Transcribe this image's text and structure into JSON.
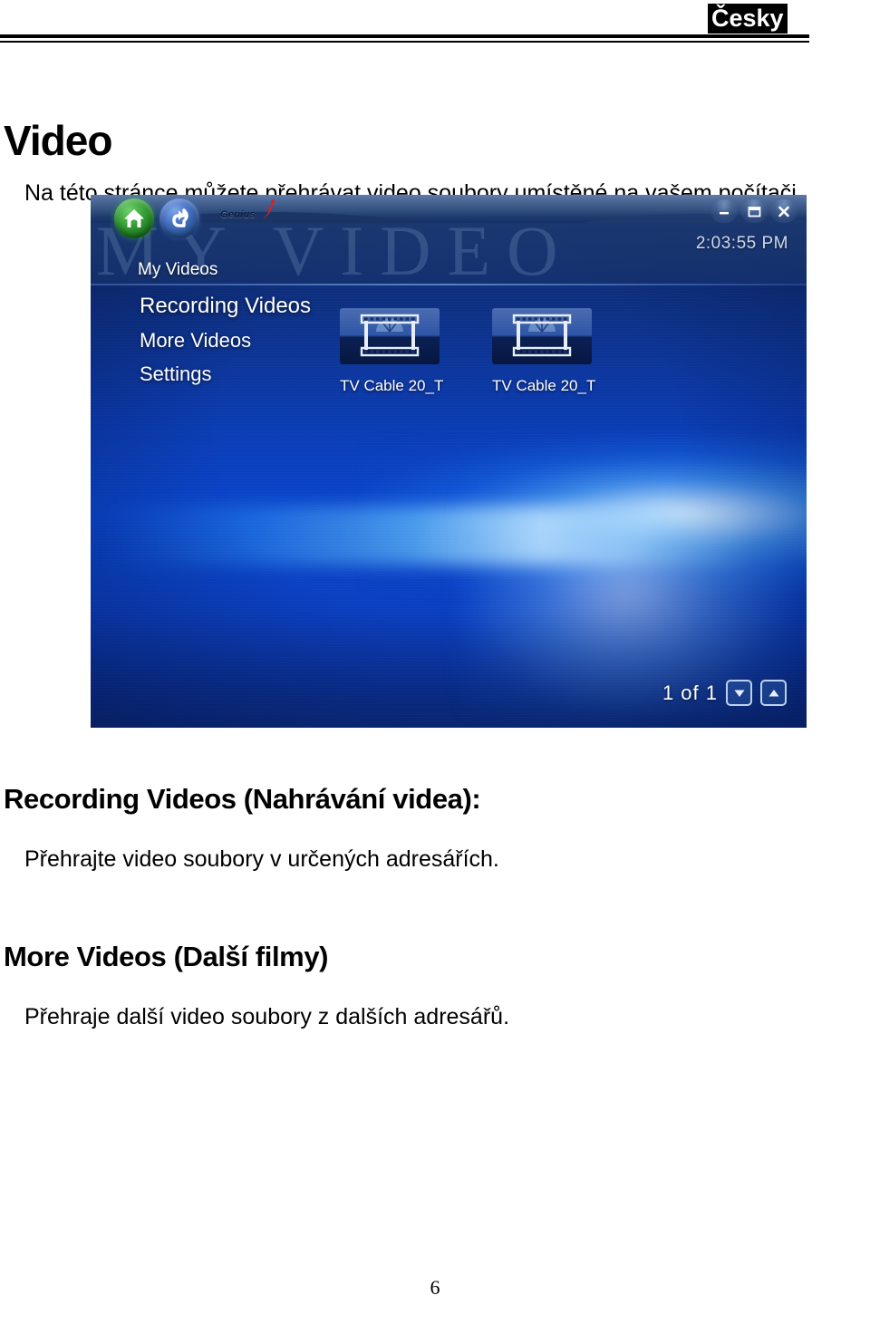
{
  "header": {
    "language_badge": "Česky",
    "rule": "double-horizontal-rule"
  },
  "document": {
    "title": "Video",
    "intro": "Na této stránce můžete přehrávat video soubory umístěné na vašem počítači.",
    "sections": [
      {
        "heading": "Recording Videos (Nahrávání videa):",
        "body": "Přehrajte video soubory v určených adresářích."
      },
      {
        "heading": "More Videos (Další filmy)",
        "body": "Přehraje další video soubory z dalších adresářů."
      }
    ],
    "page_number": "6"
  },
  "screenshot": {
    "toolbar": {
      "home_icon": "home-icon",
      "back_icon": "back-arrow-icon",
      "brand": "Genius",
      "brand_mark": "red-swoosh-icon"
    },
    "window_controls": [
      {
        "name": "minimize",
        "glyph": "minimize-icon"
      },
      {
        "name": "restore",
        "glyph": "restore-icon"
      },
      {
        "name": "close",
        "glyph": "close-icon"
      }
    ],
    "header": {
      "watermark": "MY VIDEO",
      "clock": "2:03:55 PM",
      "breadcrumb": "My Videos"
    },
    "menu": [
      {
        "label": "Recording Videos",
        "selected": true
      },
      {
        "label": "More Videos",
        "selected": false
      },
      {
        "label": "Settings",
        "selected": false
      }
    ],
    "thumbnails": [
      {
        "label": "TV Cable  20_T",
        "icon": "film-strip-icon"
      },
      {
        "label": "TV Cable  20_T",
        "icon": "film-strip-icon"
      }
    ],
    "pagination": {
      "indicator": "1  of 1",
      "prev_icon": "chevron-down-icon",
      "next_icon": "chevron-up-icon"
    },
    "colors": {
      "background_deep_blue": "#0a2a7d",
      "background_bright_blue": "#0a46cf",
      "glow_cyan": "#c4e8ff",
      "home_green": "#39a339",
      "back_blue": "#4571c2",
      "brand_red": "#d8202a",
      "text_white": "#ffffff",
      "clock_grey_blue": "#cdd9ee"
    }
  }
}
